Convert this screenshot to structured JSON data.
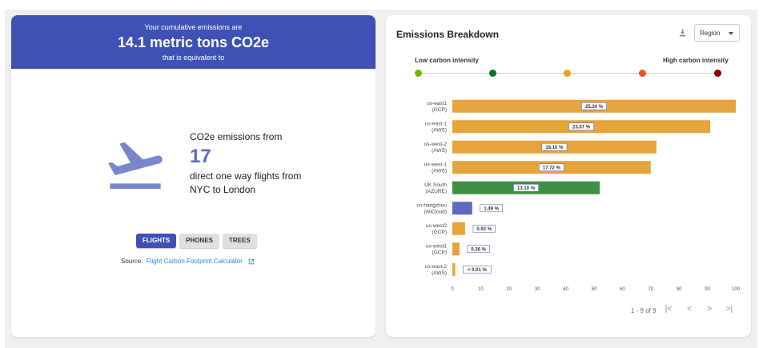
{
  "left_card": {
    "banner": {
      "line1": "Your cumulative emissions are",
      "line2": "14.1 metric tons CO2e",
      "line3": "that is equivalent to"
    },
    "equivalency": {
      "icon": "flight-takeoff-icon",
      "prefix": "CO2e emissions from",
      "value": "17",
      "suffix": "direct one way flights from NYC to London"
    },
    "tabs": [
      {
        "label": "FLIGHTS",
        "active": true
      },
      {
        "label": "PHONES",
        "active": false
      },
      {
        "label": "TREES",
        "active": false
      }
    ],
    "source": {
      "label": "Source:",
      "link": "Flight Carbon Footprint Calculator"
    },
    "accent_color": "#3f51b5"
  },
  "right_card": {
    "title": "Emissions Breakdown",
    "download_icon": "download-icon",
    "region_select": {
      "value": "Region"
    },
    "scale": {
      "low_label": "Low carbon intensity",
      "high_label": "High carbon intensity",
      "dot_colors": [
        "#73b500",
        "#0d7527",
        "#e5a428",
        "#e45522",
        "#8b0000"
      ]
    },
    "pager": {
      "text": "1 - 9 of 9"
    }
  },
  "chart_data": {
    "type": "bar",
    "orientation": "horizontal",
    "categories": [
      [
        "us-east1",
        "(GCP)"
      ],
      [
        "us-east-1",
        "(AWS)"
      ],
      [
        "us-west-2",
        "(AWS)"
      ],
      [
        "us-west-1",
        "(AWS)"
      ],
      [
        "UK South",
        "(AZURE)"
      ],
      [
        "cn-hangzhou",
        "(AliCloud)"
      ],
      [
        "us-west2",
        "(GCP)"
      ],
      [
        "us-west1",
        "(GCP)"
      ],
      [
        "us-east-2",
        "(AWS)"
      ]
    ],
    "values": [
      100,
      91,
      72,
      70,
      52,
      7,
      4.5,
      2.5,
      1
    ],
    "labels": [
      "25.24 %",
      "23.07 %",
      "18.10 %",
      "17.72 %",
      "13.10 %",
      "1.49 %",
      "0.92 %",
      "0.36 %",
      "< 0.01 %"
    ],
    "colors": [
      "#e5a43c",
      "#e5a43c",
      "#e5a43c",
      "#e5a43c",
      "#3d9140",
      "#5c6bc0",
      "#e5a43c",
      "#e5a43c",
      "#e5a43c"
    ],
    "xlim": [
      0,
      100
    ],
    "xticks": [
      "0",
      "10",
      "20",
      "30",
      "40",
      "50",
      "60",
      "70",
      "80",
      "90",
      "100"
    ]
  }
}
